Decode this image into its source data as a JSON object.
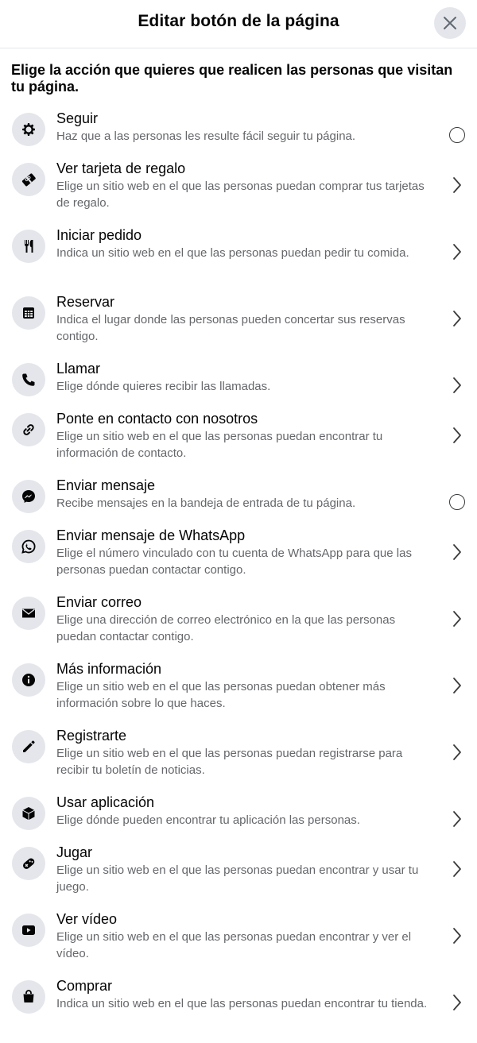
{
  "header": {
    "title": "Editar botón de la página"
  },
  "intro": "Elige la acción que quieres que realicen las personas que visitan tu página.",
  "items": [
    {
      "title": "Seguir",
      "desc": "Haz que a las personas les resulte fácil seguir tu página.",
      "icon": "gear-icon",
      "trail": "radio"
    },
    {
      "title": "Ver tarjeta de regalo",
      "desc": "Elige un sitio web en el que las personas puedan comprar tus tarjetas de regalo.",
      "icon": "gift-card-icon",
      "trail": "chevron"
    },
    {
      "title": "Iniciar pedido",
      "desc": "Indica un sitio web en el que las personas puedan pedir tu comida.",
      "icon": "fork-knife-icon",
      "trail": "chevron"
    },
    {
      "title": "Reservar",
      "desc": "Indica el lugar donde las personas pueden concertar sus reservas contigo.",
      "icon": "calendar-icon",
      "trail": "chevron"
    },
    {
      "title": "Llamar",
      "desc": "Elige dónde quieres recibir las llamadas.",
      "icon": "phone-icon",
      "trail": "chevron"
    },
    {
      "title": "Ponte en contacto con nosotros",
      "desc": "Elige un sitio web en el que las personas puedan encontrar tu información de contacto.",
      "icon": "link-icon",
      "trail": "chevron"
    },
    {
      "title": "Enviar mensaje",
      "desc": "Recibe mensajes en la bandeja de entrada de tu página.",
      "icon": "messenger-icon",
      "trail": "radio"
    },
    {
      "title": "Enviar mensaje de WhatsApp",
      "desc": "Elige el número vinculado con tu cuenta de WhatsApp para que las personas puedan contactar contigo.",
      "icon": "whatsapp-icon",
      "trail": "chevron"
    },
    {
      "title": "Enviar correo",
      "desc": "Elige una dirección de correo electrónico en la que las personas puedan contactar contigo.",
      "icon": "envelope-icon",
      "trail": "chevron"
    },
    {
      "title": "Más información",
      "desc": "Elige un sitio web en el que las personas puedan obtener más información sobre lo que haces.",
      "icon": "info-icon",
      "trail": "chevron"
    },
    {
      "title": "Registrarte",
      "desc": "Elige un sitio web en el que las personas puedan registrarse para recibir tu boletín de noticias.",
      "icon": "pencil-icon",
      "trail": "chevron"
    },
    {
      "title": "Usar aplicación",
      "desc": "Elige dónde pueden encontrar tu aplicación las personas.",
      "icon": "cube-icon",
      "trail": "chevron"
    },
    {
      "title": "Jugar",
      "desc": "Elige un sitio web en el que las personas puedan encontrar y usar tu juego.",
      "icon": "gamepad-icon",
      "trail": "chevron"
    },
    {
      "title": "Ver vídeo",
      "desc": "Elige un sitio web en el que las personas puedan encontrar y ver el vídeo.",
      "icon": "play-icon",
      "trail": "chevron"
    },
    {
      "title": "Comprar",
      "desc": "Indica un sitio web en el que las personas puedan encontrar tu tienda.",
      "icon": "shopping-bag-icon",
      "trail": "chevron"
    }
  ],
  "colors": {
    "icon_bg": "#e4e6eb",
    "primary_text": "#050505",
    "secondary_text": "#65676b"
  }
}
